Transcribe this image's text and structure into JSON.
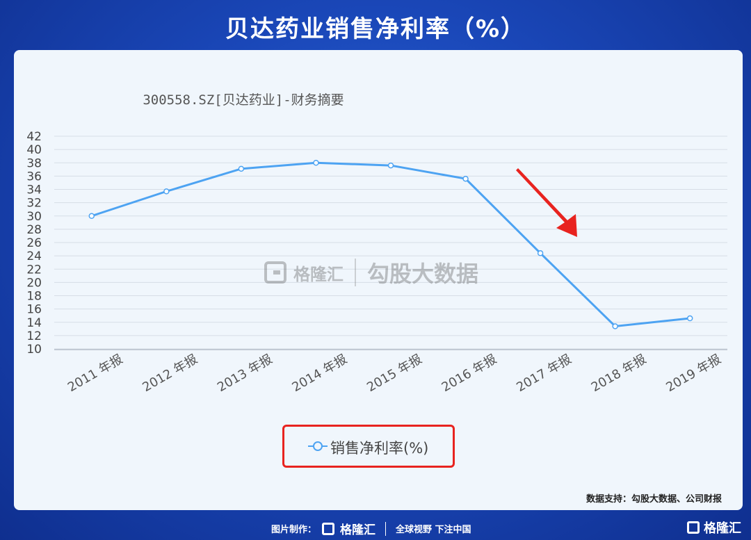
{
  "banner": {
    "title": "贝达药业销售净利率（%）"
  },
  "chart_data": {
    "type": "line",
    "title": "300558.SZ[贝达药业]-财务摘要",
    "categories": [
      "2011 年报",
      "2012 年报",
      "2013 年报",
      "2014 年报",
      "2015 年报",
      "2016 年报",
      "2017 年报",
      "2018 年报",
      "2019 年报"
    ],
    "series": [
      {
        "name": "销售净利率(%)",
        "values": [
          30.0,
          33.7,
          37.1,
          38.0,
          37.6,
          35.6,
          24.4,
          13.4,
          14.6
        ]
      }
    ],
    "yticks": [
      10,
      12,
      14,
      16,
      18,
      20,
      22,
      24,
      26,
      28,
      30,
      32,
      34,
      36,
      38,
      40,
      42
    ],
    "ylim": [
      10,
      42
    ],
    "grid": true,
    "legend_position": "bottom",
    "colors": {
      "line": "#4da3f2",
      "arrow": "#e8231f",
      "legend_border": "#e8231f"
    }
  },
  "watermark": {
    "brand": "格隆汇",
    "product": "勾股大数据"
  },
  "source_note": "数据支持：勾股大数据、公司财报",
  "footer": {
    "made_by_label": "图片制作：",
    "brand": "格隆汇",
    "slogan": "全球视野 下注中国",
    "corner_brand": "格隆汇"
  }
}
